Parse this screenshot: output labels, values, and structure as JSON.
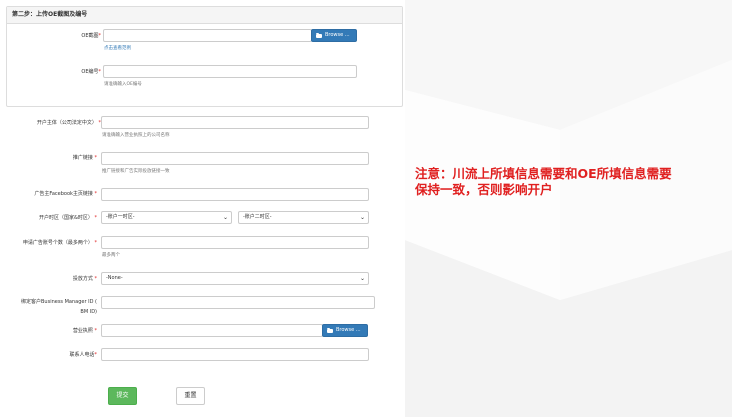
{
  "colors": {
    "primary": "#337ab7",
    "success": "#5cb85c",
    "required": "#e02020",
    "notice": "#e02020"
  },
  "step_panel": {
    "title": "第二步：上传OE截图及编号",
    "oe_screenshot": {
      "label": "OE截图",
      "required_mark": "*",
      "browse_label": "Browse ...",
      "link": "点击查看范例"
    },
    "oe_number": {
      "label": "OE编号",
      "required_mark": "*",
      "value": "",
      "help": "请准确输入OE编号"
    }
  },
  "form": {
    "account_entity": {
      "label": "开户主体（公司法定中文）",
      "required_mark": "*",
      "value": "",
      "help": "请准确输入营业执照上的公司名称"
    },
    "promo_link": {
      "label": "推广链接",
      "required_mark": "*",
      "value": "",
      "help": "推广链接和广告实际投放链接一致"
    },
    "facebook_page": {
      "label": "广告主Facebook主页链接",
      "required_mark": "*",
      "value": ""
    },
    "timezone": {
      "label": "开户时区（国家&时区）",
      "required_mark": "*",
      "select1": "-账户一时区-",
      "select2": "-账户二时区-"
    },
    "account_count": {
      "label": "申请广告账号个数（最多两个）",
      "required_mark": "*",
      "value": "",
      "help": "最多两个"
    },
    "delivery_method": {
      "label": "投放方式",
      "required_mark": "*",
      "select": "-None-"
    },
    "bm_id": {
      "label_line1": "绑定客户Business Manager ID (",
      "label_line2": "BM ID)",
      "value": ""
    },
    "business_license": {
      "label": "营业执照",
      "required_mark": "*",
      "browse_label": "Browse ..."
    },
    "contact_phone": {
      "label": "联系人电话",
      "required_mark": "*",
      "value": ""
    },
    "submit_label": "提交",
    "reset_label": "重置"
  },
  "notice": {
    "line1": "注意：川流上所填信息需要和OE所填信息需要",
    "line2": "保持一致，否则影响开户"
  }
}
